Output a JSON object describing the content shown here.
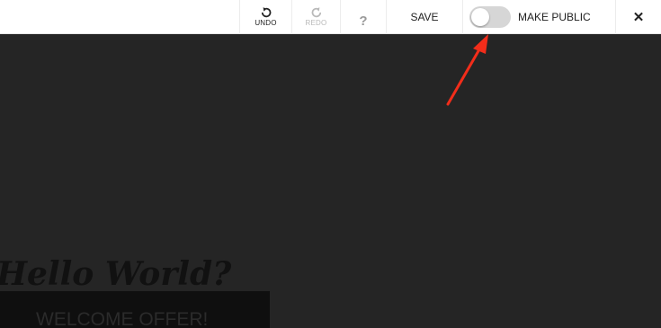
{
  "toolbar": {
    "undo_label": "UNDO",
    "redo_label": "REDO",
    "help_label": "?",
    "save_label": "SAVE",
    "make_public_label": "MAKE PUBLIC",
    "make_public_enabled": false,
    "close_label": "✕"
  },
  "canvas": {
    "heading": "Hello World?",
    "offer_text": "WELCOME OFFER!"
  },
  "colors": {
    "canvas_bg": "#252525",
    "toolbar_bg": "#ffffff",
    "arrow": "#f22d1a"
  }
}
